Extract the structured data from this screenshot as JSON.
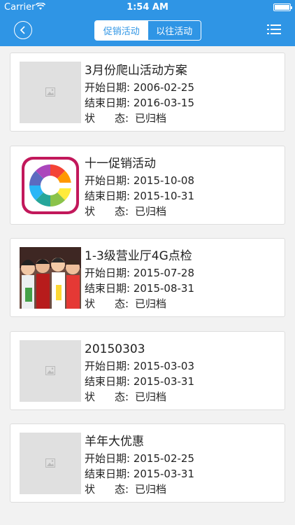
{
  "status_bar": {
    "carrier": "Carrier",
    "time": "1:54 AM"
  },
  "nav": {
    "tabs": [
      "促销活动",
      "以往活动"
    ],
    "active_tab": 1
  },
  "labels": {
    "start": "开始日期: ",
    "end": "结束日期: ",
    "status_a": "状",
    "status_b": "态: "
  },
  "items": [
    {
      "title": "3月份爬山活动方案",
      "start": "2006-02-25",
      "end": "2016-03-15",
      "status": "已归档",
      "image": "placeholder"
    },
    {
      "title": "十一促销活动",
      "start": "2015-10-08",
      "end": "2015-10-31",
      "status": "已归档",
      "image": "color-g-logo"
    },
    {
      "title": "1-3级营业厅4G点检",
      "start": "2015-07-28",
      "end": "2015-08-31",
      "status": "已归档",
      "image": "people-photo"
    },
    {
      "title": "20150303",
      "start": "2015-03-03",
      "end": "2015-03-31",
      "status": "已归档",
      "image": "placeholder"
    },
    {
      "title": "羊年大优惠",
      "start": "2015-02-25",
      "end": "2015-03-31",
      "status": "已归档",
      "image": "placeholder"
    }
  ],
  "colors": {
    "header": "#2f95e5",
    "background": "#f2f2f2"
  }
}
